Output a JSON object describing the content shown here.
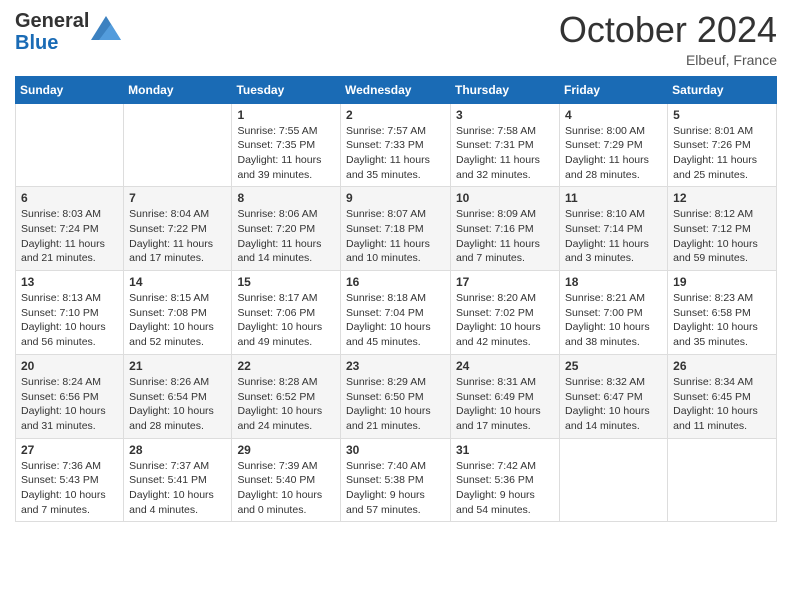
{
  "logo": {
    "general": "General",
    "blue": "Blue"
  },
  "header": {
    "month": "October 2024",
    "location": "Elbeuf, France"
  },
  "days_of_week": [
    "Sunday",
    "Monday",
    "Tuesday",
    "Wednesday",
    "Thursday",
    "Friday",
    "Saturday"
  ],
  "weeks": [
    [
      {
        "day": null
      },
      {
        "day": null
      },
      {
        "day": "1",
        "sunrise": "Sunrise: 7:55 AM",
        "sunset": "Sunset: 7:35 PM",
        "daylight": "Daylight: 11 hours and 39 minutes."
      },
      {
        "day": "2",
        "sunrise": "Sunrise: 7:57 AM",
        "sunset": "Sunset: 7:33 PM",
        "daylight": "Daylight: 11 hours and 35 minutes."
      },
      {
        "day": "3",
        "sunrise": "Sunrise: 7:58 AM",
        "sunset": "Sunset: 7:31 PM",
        "daylight": "Daylight: 11 hours and 32 minutes."
      },
      {
        "day": "4",
        "sunrise": "Sunrise: 8:00 AM",
        "sunset": "Sunset: 7:29 PM",
        "daylight": "Daylight: 11 hours and 28 minutes."
      },
      {
        "day": "5",
        "sunrise": "Sunrise: 8:01 AM",
        "sunset": "Sunset: 7:26 PM",
        "daylight": "Daylight: 11 hours and 25 minutes."
      }
    ],
    [
      {
        "day": "6",
        "sunrise": "Sunrise: 8:03 AM",
        "sunset": "Sunset: 7:24 PM",
        "daylight": "Daylight: 11 hours and 21 minutes."
      },
      {
        "day": "7",
        "sunrise": "Sunrise: 8:04 AM",
        "sunset": "Sunset: 7:22 PM",
        "daylight": "Daylight: 11 hours and 17 minutes."
      },
      {
        "day": "8",
        "sunrise": "Sunrise: 8:06 AM",
        "sunset": "Sunset: 7:20 PM",
        "daylight": "Daylight: 11 hours and 14 minutes."
      },
      {
        "day": "9",
        "sunrise": "Sunrise: 8:07 AM",
        "sunset": "Sunset: 7:18 PM",
        "daylight": "Daylight: 11 hours and 10 minutes."
      },
      {
        "day": "10",
        "sunrise": "Sunrise: 8:09 AM",
        "sunset": "Sunset: 7:16 PM",
        "daylight": "Daylight: 11 hours and 7 minutes."
      },
      {
        "day": "11",
        "sunrise": "Sunrise: 8:10 AM",
        "sunset": "Sunset: 7:14 PM",
        "daylight": "Daylight: 11 hours and 3 minutes."
      },
      {
        "day": "12",
        "sunrise": "Sunrise: 8:12 AM",
        "sunset": "Sunset: 7:12 PM",
        "daylight": "Daylight: 10 hours and 59 minutes."
      }
    ],
    [
      {
        "day": "13",
        "sunrise": "Sunrise: 8:13 AM",
        "sunset": "Sunset: 7:10 PM",
        "daylight": "Daylight: 10 hours and 56 minutes."
      },
      {
        "day": "14",
        "sunrise": "Sunrise: 8:15 AM",
        "sunset": "Sunset: 7:08 PM",
        "daylight": "Daylight: 10 hours and 52 minutes."
      },
      {
        "day": "15",
        "sunrise": "Sunrise: 8:17 AM",
        "sunset": "Sunset: 7:06 PM",
        "daylight": "Daylight: 10 hours and 49 minutes."
      },
      {
        "day": "16",
        "sunrise": "Sunrise: 8:18 AM",
        "sunset": "Sunset: 7:04 PM",
        "daylight": "Daylight: 10 hours and 45 minutes."
      },
      {
        "day": "17",
        "sunrise": "Sunrise: 8:20 AM",
        "sunset": "Sunset: 7:02 PM",
        "daylight": "Daylight: 10 hours and 42 minutes."
      },
      {
        "day": "18",
        "sunrise": "Sunrise: 8:21 AM",
        "sunset": "Sunset: 7:00 PM",
        "daylight": "Daylight: 10 hours and 38 minutes."
      },
      {
        "day": "19",
        "sunrise": "Sunrise: 8:23 AM",
        "sunset": "Sunset: 6:58 PM",
        "daylight": "Daylight: 10 hours and 35 minutes."
      }
    ],
    [
      {
        "day": "20",
        "sunrise": "Sunrise: 8:24 AM",
        "sunset": "Sunset: 6:56 PM",
        "daylight": "Daylight: 10 hours and 31 minutes."
      },
      {
        "day": "21",
        "sunrise": "Sunrise: 8:26 AM",
        "sunset": "Sunset: 6:54 PM",
        "daylight": "Daylight: 10 hours and 28 minutes."
      },
      {
        "day": "22",
        "sunrise": "Sunrise: 8:28 AM",
        "sunset": "Sunset: 6:52 PM",
        "daylight": "Daylight: 10 hours and 24 minutes."
      },
      {
        "day": "23",
        "sunrise": "Sunrise: 8:29 AM",
        "sunset": "Sunset: 6:50 PM",
        "daylight": "Daylight: 10 hours and 21 minutes."
      },
      {
        "day": "24",
        "sunrise": "Sunrise: 8:31 AM",
        "sunset": "Sunset: 6:49 PM",
        "daylight": "Daylight: 10 hours and 17 minutes."
      },
      {
        "day": "25",
        "sunrise": "Sunrise: 8:32 AM",
        "sunset": "Sunset: 6:47 PM",
        "daylight": "Daylight: 10 hours and 14 minutes."
      },
      {
        "day": "26",
        "sunrise": "Sunrise: 8:34 AM",
        "sunset": "Sunset: 6:45 PM",
        "daylight": "Daylight: 10 hours and 11 minutes."
      }
    ],
    [
      {
        "day": "27",
        "sunrise": "Sunrise: 7:36 AM",
        "sunset": "Sunset: 5:43 PM",
        "daylight": "Daylight: 10 hours and 7 minutes."
      },
      {
        "day": "28",
        "sunrise": "Sunrise: 7:37 AM",
        "sunset": "Sunset: 5:41 PM",
        "daylight": "Daylight: 10 hours and 4 minutes."
      },
      {
        "day": "29",
        "sunrise": "Sunrise: 7:39 AM",
        "sunset": "Sunset: 5:40 PM",
        "daylight": "Daylight: 10 hours and 0 minutes."
      },
      {
        "day": "30",
        "sunrise": "Sunrise: 7:40 AM",
        "sunset": "Sunset: 5:38 PM",
        "daylight": "Daylight: 9 hours and 57 minutes."
      },
      {
        "day": "31",
        "sunrise": "Sunrise: 7:42 AM",
        "sunset": "Sunset: 5:36 PM",
        "daylight": "Daylight: 9 hours and 54 minutes."
      },
      {
        "day": null
      },
      {
        "day": null
      }
    ]
  ]
}
